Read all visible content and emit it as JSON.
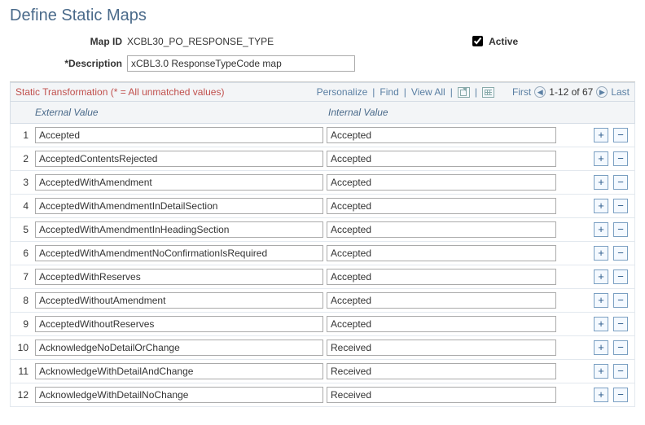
{
  "page": {
    "title": "Define Static Maps"
  },
  "form": {
    "map_id_label": "Map ID",
    "map_id_value": "XCBL30_PO_RESPONSE_TYPE",
    "active_label": "Active",
    "active_checked": true,
    "description_label": "*Description",
    "description_value": "xCBL3.0 ResponseTypeCode map"
  },
  "grid": {
    "header_title": "Static Transformation (* = All unmatched values)",
    "toolbar": {
      "personalize": "Personalize",
      "find": "Find",
      "view_all": "View All",
      "first": "First",
      "count": "1-12 of 67",
      "last": "Last"
    },
    "columns": {
      "external": "External Value",
      "internal": "Internal Value"
    },
    "rows": [
      {
        "n": 1,
        "external": "Accepted",
        "internal": "Accepted"
      },
      {
        "n": 2,
        "external": "AcceptedContentsRejected",
        "internal": "Accepted"
      },
      {
        "n": 3,
        "external": "AcceptedWithAmendment",
        "internal": "Accepted"
      },
      {
        "n": 4,
        "external": "AcceptedWithAmendmentInDetailSection",
        "internal": "Accepted"
      },
      {
        "n": 5,
        "external": "AcceptedWithAmendmentInHeadingSection",
        "internal": "Accepted"
      },
      {
        "n": 6,
        "external": "AcceptedWithAmendmentNoConfirmationIsRequired",
        "internal": "Accepted"
      },
      {
        "n": 7,
        "external": "AcceptedWithReserves",
        "internal": "Accepted"
      },
      {
        "n": 8,
        "external": "AcceptedWithoutAmendment",
        "internal": "Accepted"
      },
      {
        "n": 9,
        "external": "AcceptedWithoutReserves",
        "internal": "Accepted"
      },
      {
        "n": 10,
        "external": "AcknowledgeNoDetailOrChange",
        "internal": "Received"
      },
      {
        "n": 11,
        "external": "AcknowledgeWithDetailAndChange",
        "internal": "Received"
      },
      {
        "n": 12,
        "external": "AcknowledgeWithDetailNoChange",
        "internal": "Received"
      }
    ]
  }
}
